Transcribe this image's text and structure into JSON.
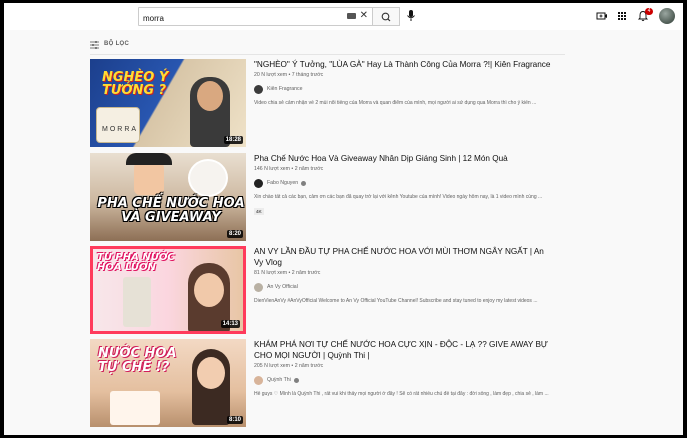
{
  "search": {
    "query": "morra"
  },
  "colors": {
    "notification": "#cc0000",
    "thumb1_bg": "#1c3f8c",
    "thumb3_border": "#ff3b5c"
  },
  "filter": {
    "label": "BỘ LỌC",
    "icon": "filter-icon"
  },
  "header": {
    "notification_count": "4"
  },
  "results": [
    {
      "title": "\"NGHÈO\" Ý Tưởng, \"LÙA GÀ\" Hay Là Thành Công Của Morra ?!| Kiên Fragrance",
      "views_time": "20 N lượt xem • 7 tháng trước",
      "channel": "Kiên Fragrance",
      "description": "Video chia sẻ cảm nhận về 2 mùi nổi tiếng của Morra và quan điểm của mình, mọi người ai sử dụng qua Morra thì cho ý kiến ...",
      "duration": "18:28",
      "thumb_text": "NGHÈO Ý TƯỞNG ?",
      "thumb_sub": "MORRA"
    },
    {
      "title": "Pha Chế Nước Hoa Và Giveaway Nhân Dịp Giáng Sinh | 12 Món Quà",
      "views_time": "146 N lượt xem • 2 năm trước",
      "channel": "Fabo Nguyen",
      "description": "Xin chào tất cả các bạn, cảm ơn các bạn đã quay trở lại với kênh Youtube của mình! Video ngày hôm nay, là 1 video mình cùng ...",
      "badge": "4K",
      "duration": "8:20",
      "thumb_text": "PHA CHẾ NƯỚC HOA VÀ GIVEAWAY",
      "thumb_sub": ""
    },
    {
      "title": "AN VY LẦN ĐẦU TỰ PHA CHẾ NƯỚC HOA VỚI MÙI THƠM NGÂY NGẤT | An Vy Vlog",
      "views_time": "81 N lượt xem • 2 năm trước",
      "channel": "An Vy Official",
      "description": "DienVienAnVy #AnVyOfficial Welcome to An Vy Official YouTube Channel! Subscribe and stay tuned to enjoy my latest videos ...",
      "duration": "14:13",
      "thumb_text": "TỰ PHA NƯỚC HOA LUÔN",
      "thumb_sub": ""
    },
    {
      "title": "KHÁM PHÁ NƠI TỰ CHẾ NƯỚC HOA CỰC XỊN - ĐỘC - LẠ ?? GIVE AWAY BỰ CHO MỌI NGƯỜI | Quỳnh Thi |",
      "views_time": "205 N lượt xem • 2 năm trước",
      "channel": "Quỳnh Thi",
      "description": "Hế guys ♡ Mình là Quỳnh Thi , rất vui khi thấy mọi người ở đây ! Sẽ có rất nhiều chủ đề tại đây : đời sống , làm đẹp , chia sẻ , làm ...",
      "duration": "8:10",
      "thumb_text": "NƯỚC HOA TỰ CHẾ !?",
      "thumb_sub": ""
    }
  ]
}
